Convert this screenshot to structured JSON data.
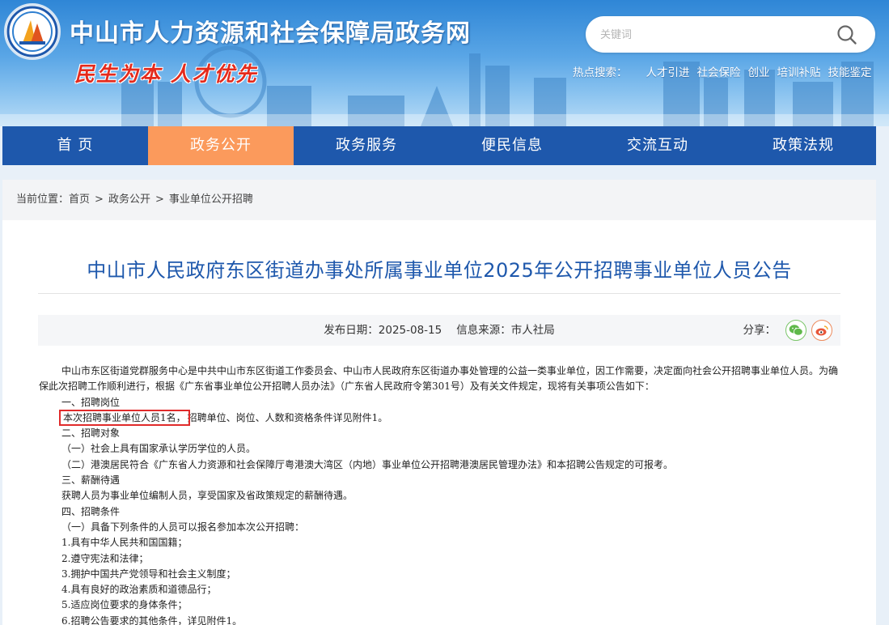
{
  "header": {
    "site_title": "中山市人力资源和社会保障局政务网",
    "slogan": "民生为本 人才优先",
    "search": {
      "placeholder": "关键词"
    },
    "hot_label": "热点搜索：",
    "hot_links": [
      "人才引进",
      "社会保险",
      "创业",
      "培训补贴",
      "技能鉴定"
    ]
  },
  "nav": {
    "items": [
      "首 页",
      "政务公开",
      "政务服务",
      "便民信息",
      "交流互动",
      "政策法规"
    ],
    "active_index": 1
  },
  "breadcrumb": {
    "label": "当前位置：",
    "items": [
      "首页",
      "政务公开",
      "事业单位公开招聘"
    ],
    "separator": ">"
  },
  "article": {
    "title": "中山市人民政府东区街道办事处所属事业单位2025年公开招聘事业单位人员公告",
    "meta": {
      "date_label": "发布日期：",
      "date": "2025-08-15",
      "source_label": "信息来源：",
      "source": "市人社局",
      "share_label": "分享："
    },
    "paragraphs": {
      "intro": "中山市东区街道党群服务中心是中共中山市东区街道工作委员会、中山市人民政府东区街道办事处管理的公益一类事业单位，因工作需要，决定面向社会公开招聘事业单位人员。为确保此次招聘工作顺利进行，根据《广东省事业单位公开招聘人员办法》（广东省人民政府令第301号）及有关文件规定，现将有关事项公告如下：",
      "s1": "一、招聘岗位",
      "s1_highlight": "本次招聘事业单位人员1名，",
      "s1_rest": "招聘单位、岗位、人数和资格条件详见附件1。",
      "s2": "二、招聘对象",
      "s2_p1": "（一）社会上具有国家承认学历学位的人员。",
      "s2_p2": "（二）港澳居民符合《广东省人力资源和社会保障厅粤港澳大湾区（内地）事业单位公开招聘港澳居民管理办法》和本招聘公告规定的可报考。",
      "s3": "三、薪酬待遇",
      "s3_p1": "获聘人员为事业单位编制人员，享受国家及省政策规定的薪酬待遇。",
      "s4": "四、招聘条件",
      "s4_p1": "（一）具备下列条件的人员可以报名参加本次公开招聘：",
      "conditions": [
        "1.具有中华人民共和国国籍；",
        "2.遵守宪法和法律；",
        "3.拥护中国共产党领导和社会主义制度；",
        "4.具有良好的政治素质和道德品行；",
        "5.适应岗位要求的身体条件；",
        "6.招聘公告要求的其他条件，详见附件1。"
      ]
    }
  },
  "colors": {
    "nav_bg": "#1e58ac",
    "nav_active": "#fb9a5c",
    "title_blue": "#1e58ac",
    "highlight_border": "#e02b2b",
    "slogan_red": "#e42a1c"
  }
}
